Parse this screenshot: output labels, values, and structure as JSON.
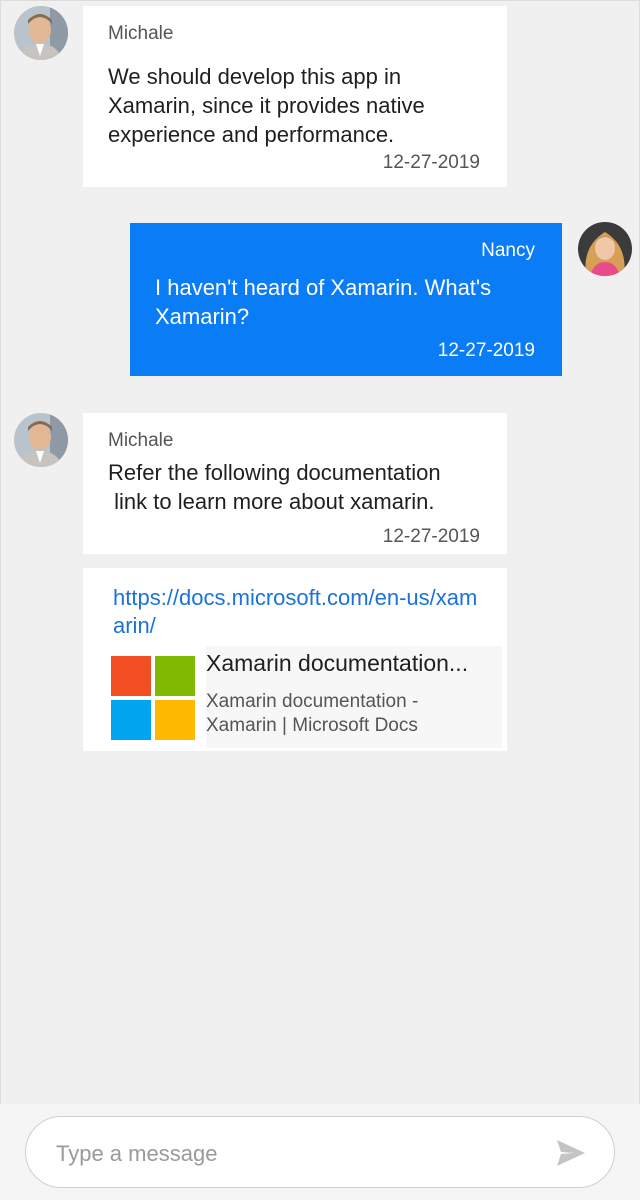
{
  "messages": [
    {
      "author": "Michale",
      "text": "We should develop this app in\nXamarin, since it provides native\nexperience and performance.",
      "date": "12-27-2019",
      "avatar": "male-avatar"
    },
    {
      "author": "Nancy",
      "text": "I haven't heard of Xamarin. What's\nXamarin?",
      "date": "12-27-2019",
      "avatar": "female-avatar"
    },
    {
      "author": "Michale",
      "text": "Refer the following documentation\n link to learn more about xamarin.",
      "date": "12-27-2019",
      "avatar": "male-avatar"
    }
  ],
  "link_message": {
    "url": "https://docs.microsoft.com/en-us/xamarin/",
    "preview_title": "Xamarin documentation...",
    "preview_description": "Xamarin documentation -\nXamarin | Microsoft Docs",
    "preview_image": "microsoft-logo"
  },
  "composer": {
    "placeholder": "Type a message",
    "send_icon": "send-icon"
  },
  "colors": {
    "outgoing_bubble": "#0a7cf6",
    "incoming_bubble": "#ffffff",
    "background": "#f0f0f0",
    "link": "#1a73d9",
    "ms_red": "#f25022",
    "ms_green": "#7fba00",
    "ms_blue": "#00a4ef",
    "ms_yellow": "#ffb900"
  }
}
